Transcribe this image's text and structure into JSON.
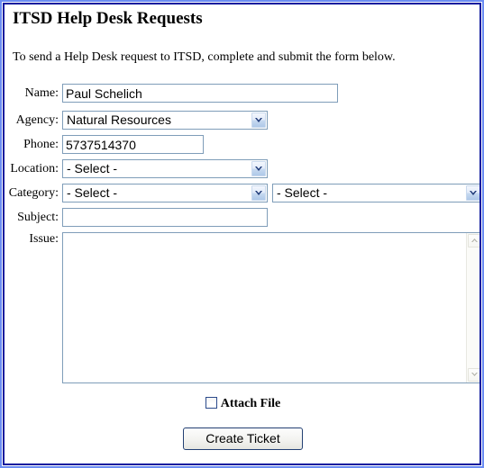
{
  "page": {
    "title": "ITSD Help Desk Requests",
    "intro": "To send a Help Desk request to ITSD, complete and submit the form below."
  },
  "form": {
    "name": {
      "label": "Name:",
      "value": "Paul Schelich",
      "placeholder": ""
    },
    "agency": {
      "label": "Agency:",
      "value": "Natural Resources"
    },
    "phone": {
      "label": "Phone:",
      "value": "5737514370",
      "placeholder": ""
    },
    "location": {
      "label": "Location:",
      "value": "- Select -"
    },
    "category": {
      "label": "Category:",
      "value": "- Select -",
      "subcategory_value": "- Select -"
    },
    "subject": {
      "label": "Subject:",
      "value": "",
      "placeholder": ""
    },
    "issue": {
      "label": "Issue:",
      "value": "",
      "placeholder": ""
    },
    "attach_file": {
      "label": "Attach File",
      "checked": false
    },
    "submit": {
      "label": "Create Ticket"
    }
  },
  "colors": {
    "frame_outer": "#6b8cf2",
    "frame_inner": "#0e1a9e",
    "input_border": "#7f9db9",
    "dropdown_arrow": "#1f3a78",
    "button_border": "#234073",
    "checkbox_border": "#2b4a8b",
    "scroll_arrow": "#b4b4ac"
  }
}
